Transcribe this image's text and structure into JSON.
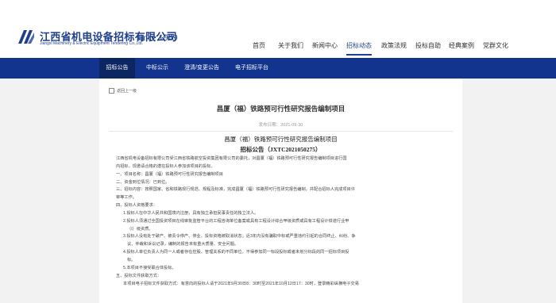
{
  "brand": {
    "name_cn": "江西省机电设备招标有限公司",
    "name_en": "Jiangxi Machinery & Electric Equipment Tendering Co.,Ltd.",
    "since": "since 1989"
  },
  "nav": {
    "items": [
      {
        "label": "首页"
      },
      {
        "label": "关于我们"
      },
      {
        "label": "新闻中心"
      },
      {
        "label": "招标动态"
      },
      {
        "label": "政策法规"
      },
      {
        "label": "投标自助"
      },
      {
        "label": "经典案例"
      },
      {
        "label": "党群文化"
      }
    ],
    "active_index": 3
  },
  "subnav": {
    "tabs": [
      {
        "label": "招标公告"
      },
      {
        "label": "中标公示"
      },
      {
        "label": "澄清/变更公告"
      },
      {
        "label": "电子招标平台"
      }
    ],
    "active_index": 0
  },
  "article": {
    "back_label": "返回上一级",
    "title": "昌厦（福）铁路预可行性研究报告编制项目",
    "date": "发布日期：2021-09-30",
    "heading_line1": "昌厦（福）铁路预可行性研究报告编制项目",
    "heading_line2": "招标公告（JXTC2021050275）",
    "paragraphs": [
      "江西省机电设备招标有限公司受江西省铁路航空投资集团有限公司的委托，对昌厦（福）铁路预可行性研究报告编制项目进行国",
      "内招标，现邀请合格的潜在投标人参加该项目的投标。",
      "一、项目名称：昌厦（福）铁路预可行性研究报告编制项目",
      "二、资金到位情况：已到位。",
      "三、招标内容：按照国家、省和铁路现行规范、规程及标准，完成昌厦（福）铁路预可行性研究报告编制，并配合招标人完成项目许",
      "审等工作。",
      "四、投标人资格要求：",
      "1.投标人在中华人民共和国境内注册，具有独立承担民事责任的独立法人。",
      "2.投标人须通过全国投资项目在线审批监管平台的工程咨询单位备案或具有工程设计综合甲级资质或具有工程设计铁道行业甲",
      "（I）级资质。",
      "3.投标人没有处于破产、被责令停产、停业、投标资格被取消状态；近3年内没有骗取中标或严重违约引起的合同终止、纠纷、争",
      "议、仲裁和诉讼记录，编制的报告未有重大质量、安全问题。",
      "4.投标人单位负责人为同一人或者存在控股、管理关系的不同单位，不得参加同一标段投标或者未划分标段的同一招标项目投",
      "标。",
      "5.本项目不接受联合体投标。",
      "五、投标文件获取方式：",
      "本项目电子招标文件获取方式：有意向的投标人请于2021年9月30日8：30时至2021年10月12日17：30时，登录精彩纵横电子交易"
    ],
    "indent": [
      0,
      0,
      0,
      0,
      0,
      0,
      0,
      1,
      1,
      2,
      1,
      2,
      1,
      2,
      1,
      0,
      1
    ]
  }
}
